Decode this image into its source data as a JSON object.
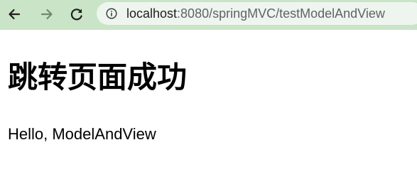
{
  "browser": {
    "back_icon": "arrow-left-icon",
    "forward_icon": "arrow-right-icon",
    "reload_icon": "reload-icon",
    "info_icon": "info-icon",
    "url_host": "localhost",
    "url_rest": ":8080/springMVC/testModelAndView",
    "toolbar_color": "#c9e4c6"
  },
  "page": {
    "heading": "跳转页面成功",
    "message": "Hello, ModelAndView"
  }
}
